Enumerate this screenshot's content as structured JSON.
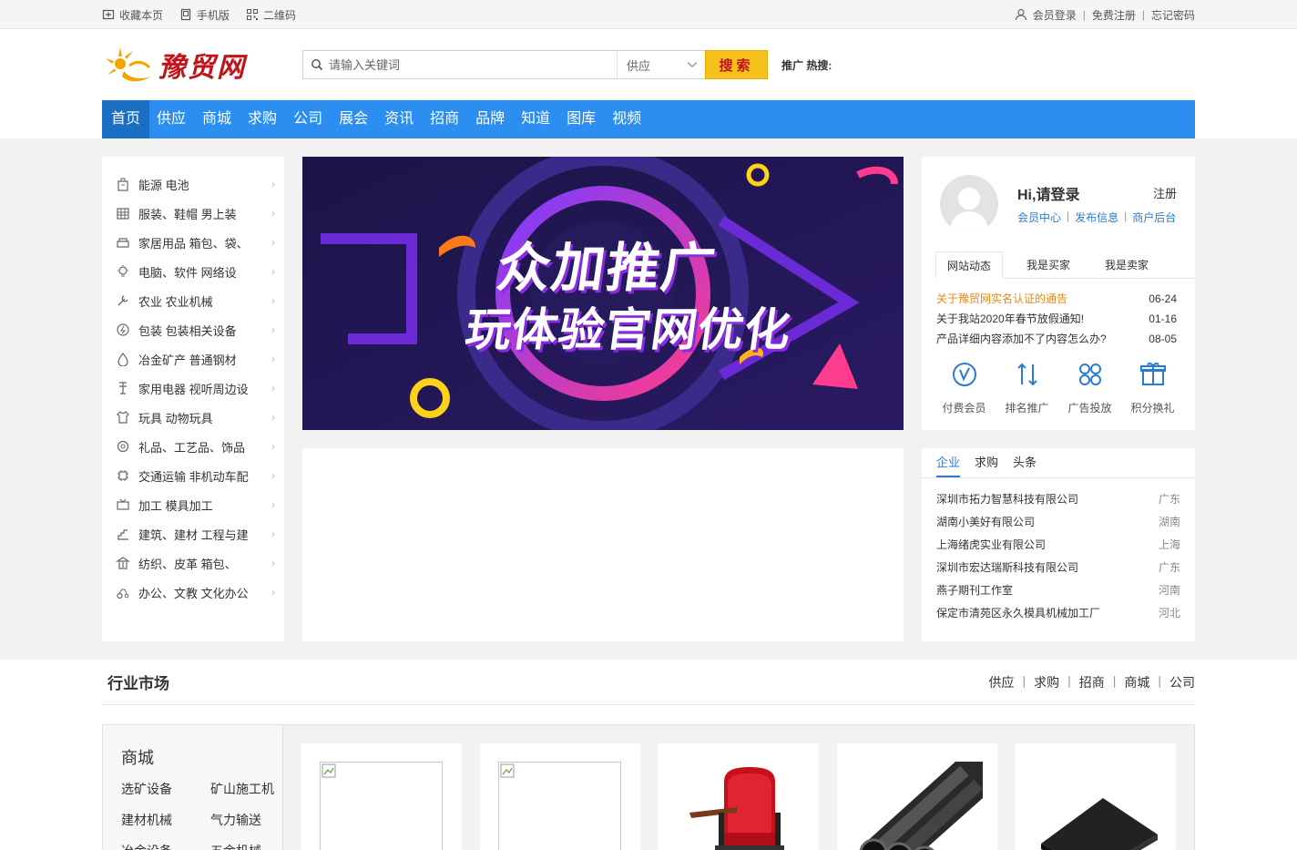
{
  "topbar": {
    "bookmark": "收藏本页",
    "mobile": "手机版",
    "qrcode": "二维码",
    "login": "会员登录",
    "register": "免费注册",
    "forgot": "忘记密码"
  },
  "header": {
    "logo_text": "豫贸网",
    "search_placeholder": "请输入关键词",
    "search_type": "供应",
    "search_button": "搜索",
    "hot_label": "推广 热搜:"
  },
  "nav": [
    "首页",
    "供应",
    "商城",
    "求购",
    "公司",
    "展会",
    "资讯",
    "招商",
    "品牌",
    "知道",
    "图库",
    "视频"
  ],
  "categories": [
    {
      "icon": "battery-icon",
      "label": "能源 电池"
    },
    {
      "icon": "building-icon",
      "label": "服装、鞋帽 男上装"
    },
    {
      "icon": "sofa-icon",
      "label": "家居用品 箱包、袋、"
    },
    {
      "icon": "bulb-icon",
      "label": "电脑、软件 网络设"
    },
    {
      "icon": "wrench-icon",
      "label": "农业 农业机械"
    },
    {
      "icon": "leaf-icon",
      "label": "包装 包装相关设备"
    },
    {
      "icon": "drop-icon",
      "label": "冶金矿产 普通钢材"
    },
    {
      "icon": "crane-icon",
      "label": "家用电器 视听周边设"
    },
    {
      "icon": "tshirt-icon",
      "label": "玩具 动物玩具"
    },
    {
      "icon": "gift-icon",
      "label": "礼品、工艺品、饰品"
    },
    {
      "icon": "chip-icon",
      "label": "交通运输 非机动车配"
    },
    {
      "icon": "tv-icon",
      "label": "加工 模具加工"
    },
    {
      "icon": "stairs-icon",
      "label": "建筑、建材 工程与建"
    },
    {
      "icon": "temple-icon",
      "label": "纺织、皮革 箱包、"
    },
    {
      "icon": "tractor-icon",
      "label": "办公、文教 文化办公"
    }
  ],
  "banner": {
    "line1": "众加推广",
    "line2": "玩体验官网优化"
  },
  "userbox": {
    "greeting": "Hi,请登录",
    "register": "注册",
    "links": [
      "会员中心",
      "发布信息",
      "商户后台"
    ],
    "tabs": [
      "网站动态",
      "我是买家",
      "我是卖家"
    ],
    "news": [
      {
        "title": "关于豫贸网实名认证的通告",
        "date": "06-24",
        "highlight": true
      },
      {
        "title": "关于我站2020年春节放假通知!",
        "date": "01-16",
        "highlight": false
      },
      {
        "title": "产品详细内容添加不了内容怎么办?",
        "date": "08-05",
        "highlight": false
      }
    ],
    "quick": [
      {
        "icon": "vip-icon",
        "label": "付费会员"
      },
      {
        "icon": "rank-icon",
        "label": "排名推广"
      },
      {
        "icon": "ads-icon",
        "label": "广告投放"
      },
      {
        "icon": "gift-box-icon",
        "label": "积分换礼"
      }
    ]
  },
  "companies": {
    "tabs": [
      "企业",
      "求购",
      "头条"
    ],
    "list": [
      {
        "name": "深圳市拓力智慧科技有限公司",
        "region": "广东"
      },
      {
        "name": "湖南小美好有限公司",
        "region": "湖南"
      },
      {
        "name": "上海绪虎实业有限公司",
        "region": "上海"
      },
      {
        "name": "深圳市宏达瑞斯科技有限公司",
        "region": "广东"
      },
      {
        "name": "燕子期刊工作室",
        "region": "河南"
      },
      {
        "name": "保定市清苑区永久模具机械加工厂",
        "region": "河北"
      }
    ]
  },
  "market": {
    "title": "行业市场",
    "links": [
      "供应",
      "求购",
      "招商",
      "商城",
      "公司"
    ],
    "section_title": "商城",
    "sub_categories": [
      "选矿设备",
      "矿山施工机",
      "建材机械",
      "气力输送",
      "冶金设备",
      "五金机械"
    ]
  },
  "colors": {
    "nav_blue": "#2b8ef0",
    "nav_active": "#1a6fc4",
    "search_yellow": "#f6c11a",
    "link_blue": "#2b7bd6",
    "highlight_orange": "#e8880f"
  }
}
